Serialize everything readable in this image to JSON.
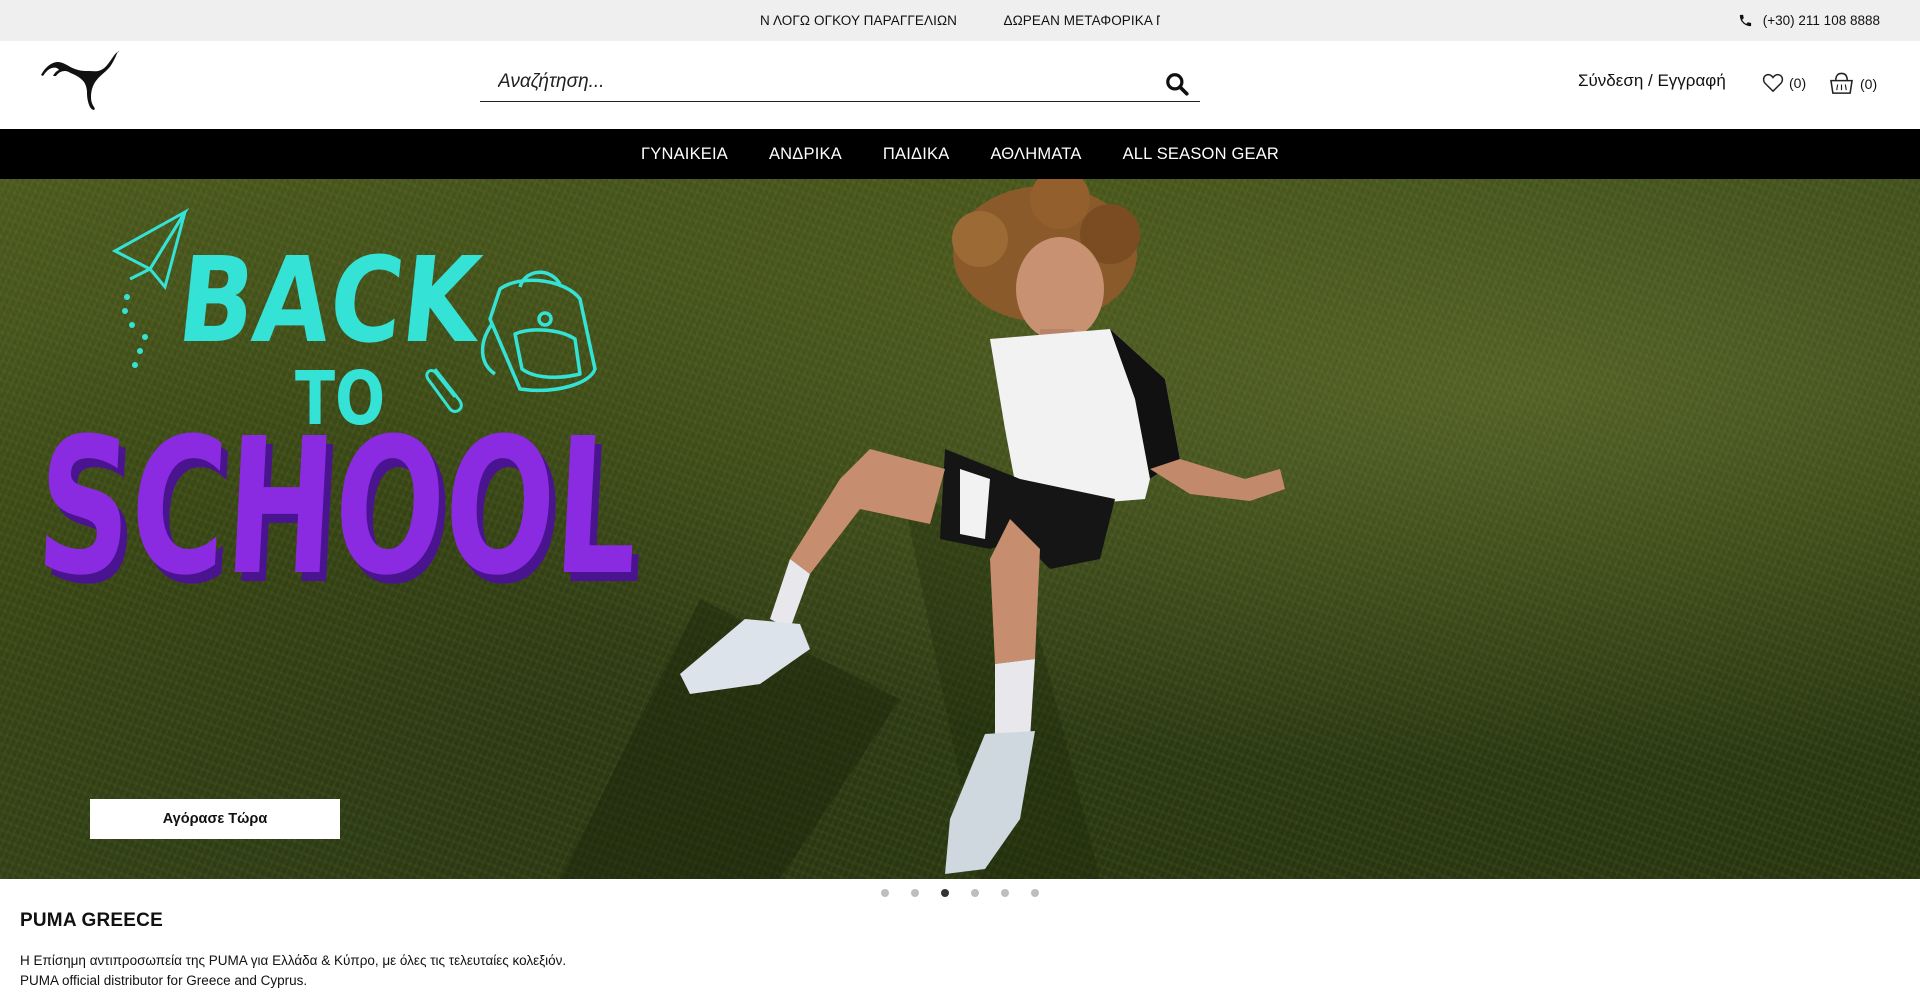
{
  "announcement": {
    "ticker_1": "Ν ΛΟΓΩ ΟΓΚΟΥ ΠΑΡΑΓΓΕΛΙΩΝ",
    "ticker_2": "ΔΩΡΕΑΝ ΜΕΤΑΦΟΡΙΚΑ ΓΙΑ",
    "phone": "(+30) 211 108 8888",
    "phone_icon": "phone-icon"
  },
  "header": {
    "logo_icon": "puma-logo",
    "search": {
      "placeholder": "Αναζήτηση...",
      "icon": "search-icon"
    },
    "login_label": "Σύνδεση / Εγγραφή",
    "wishlist_count": "(0)",
    "wishlist_icon": "heart-icon",
    "cart_count": "(0)",
    "cart_icon": "bag-icon"
  },
  "nav": {
    "items": [
      "ΓΥΝΑΙΚΕΙΑ",
      "ΑΝΔΡΙΚΑ",
      "ΠΑΙΔΙΚΑ",
      "ΑΘΛΗΜΑΤΑ",
      "ALL SEASON GEAR"
    ]
  },
  "hero": {
    "headline_top": "BACK",
    "headline_mid": "TO",
    "headline_bottom": "SCHOOL",
    "cta_label": "Αγόρασε Τώρα",
    "colors": {
      "cyan": "#34e3d6",
      "purple": "#8a2be2"
    }
  },
  "carousel": {
    "total": 6,
    "active_index": 2
  },
  "about": {
    "title": "PUMA GREECE",
    "line_1": "Η Επίσημη αντιπροσωπεία της PUMA για Ελλάδα & Κύπρο, με όλες τις τελευταίες κολεξιόν.",
    "line_2": "PUMA official distributor for Greece and Cyprus."
  }
}
